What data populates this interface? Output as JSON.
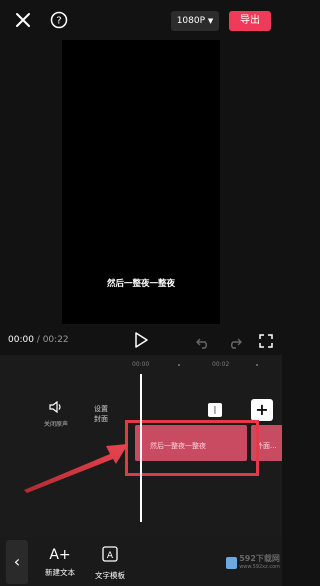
{
  "header": {
    "resolution": "1080P",
    "export_label": "导出"
  },
  "preview": {
    "subtitle": "然后一整夜一整夜"
  },
  "playback": {
    "current_time": "00:00",
    "separator": " / ",
    "duration": "00:22"
  },
  "ruler": {
    "ticks": [
      "00:00",
      "00:02"
    ]
  },
  "timeline": {
    "audio_label": "关闭原声",
    "cover_label_1": "设置",
    "cover_label_2": "封面",
    "clip_text": "然后一整夜一整夜",
    "clip2_text": "外面..."
  },
  "toolbar": {
    "items": [
      {
        "icon": "A+",
        "label": "新建文本"
      },
      {
        "icon": "A",
        "label": "文字模板"
      }
    ]
  },
  "watermark": {
    "title": "592下载网",
    "sub": "www.592xz.com"
  },
  "colors": {
    "accent": "#f03a5a",
    "clip": "#c84b62",
    "highlight": "#e23a46"
  }
}
